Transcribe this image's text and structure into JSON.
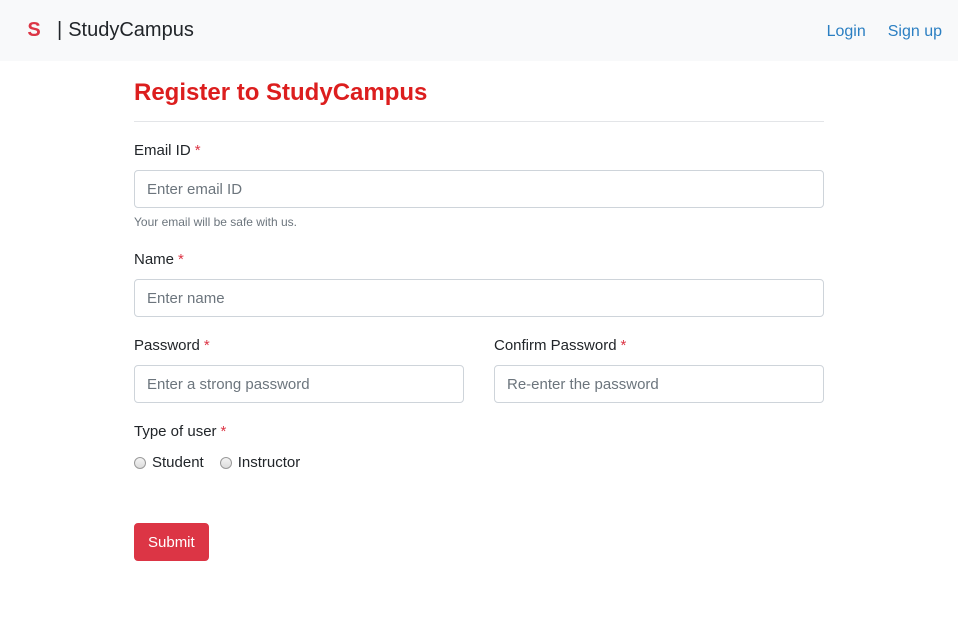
{
  "navbar": {
    "logo": "S",
    "separator": "|",
    "brand": "StudyCampus",
    "links": [
      {
        "label": "Login"
      },
      {
        "label": "Sign up"
      }
    ]
  },
  "form": {
    "title": "Register to StudyCampus",
    "required_mark": "*",
    "email": {
      "label": "Email ID",
      "placeholder": "Enter email ID",
      "value": "",
      "help": "Your email will be safe with us."
    },
    "name": {
      "label": "Name",
      "placeholder": "Enter name",
      "value": ""
    },
    "password": {
      "label": "Password",
      "placeholder": "Enter a strong password",
      "value": ""
    },
    "confirm_password": {
      "label": "Confirm Password",
      "placeholder": "Re-enter the password",
      "value": ""
    },
    "user_type": {
      "label": "Type of user",
      "options": [
        {
          "label": "Student",
          "selected": false
        },
        {
          "label": "Instructor",
          "selected": false
        }
      ]
    },
    "submit_label": "Submit"
  },
  "colors": {
    "accent": "#dc3545",
    "title": "#dc1e1e",
    "link": "#2b7fc2",
    "navbar_bg": "#f8f9fa"
  }
}
